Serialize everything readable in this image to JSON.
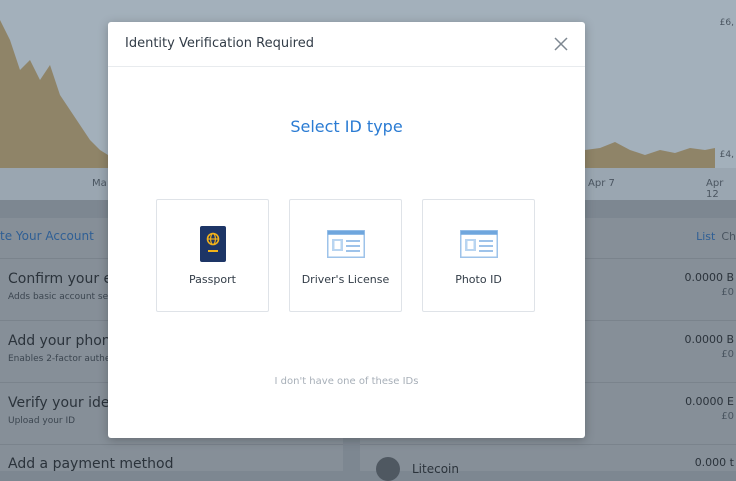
{
  "background": {
    "chart": {
      "x_labels": [
        "Ma",
        "Apr 7",
        "Apr 12"
      ],
      "y_labels": [
        "£6,",
        "£4,"
      ]
    },
    "account_panel": {
      "header": "te Your Account",
      "rows": [
        {
          "title": "Confirm your er",
          "subtitle": "Adds basic account se"
        },
        {
          "title": "Add your phon",
          "subtitle": "Enables 2-factor authe"
        },
        {
          "title": "Verify your iden",
          "subtitle": "Upload your ID"
        },
        {
          "title": "Add a payment method",
          "subtitle": ""
        }
      ]
    },
    "wallet_panel": {
      "tabs": [
        "List",
        "Ch"
      ],
      "rows": [
        {
          "value": "0.0000 B",
          "fiat": "£0"
        },
        {
          "value": "0.0000 B",
          "fiat": "£0"
        },
        {
          "value": "0.0000 E",
          "fiat": "£0"
        },
        {
          "value": "0.000 t",
          "fiat": ""
        }
      ],
      "coin_name": "Litecoin"
    }
  },
  "modal": {
    "title": "Identity Verification Required",
    "heading": "Select ID type",
    "options": [
      {
        "label": "Passport",
        "icon": "passport-icon"
      },
      {
        "label": "Driver's License",
        "icon": "id-card-icon"
      },
      {
        "label": "Photo ID",
        "icon": "id-card-icon"
      }
    ],
    "no_id_link": "I don't have one of these IDs"
  },
  "colors": {
    "accent": "#2a7bd3",
    "passport": "#1d3566",
    "passport_emblem": "#f2b21a"
  }
}
